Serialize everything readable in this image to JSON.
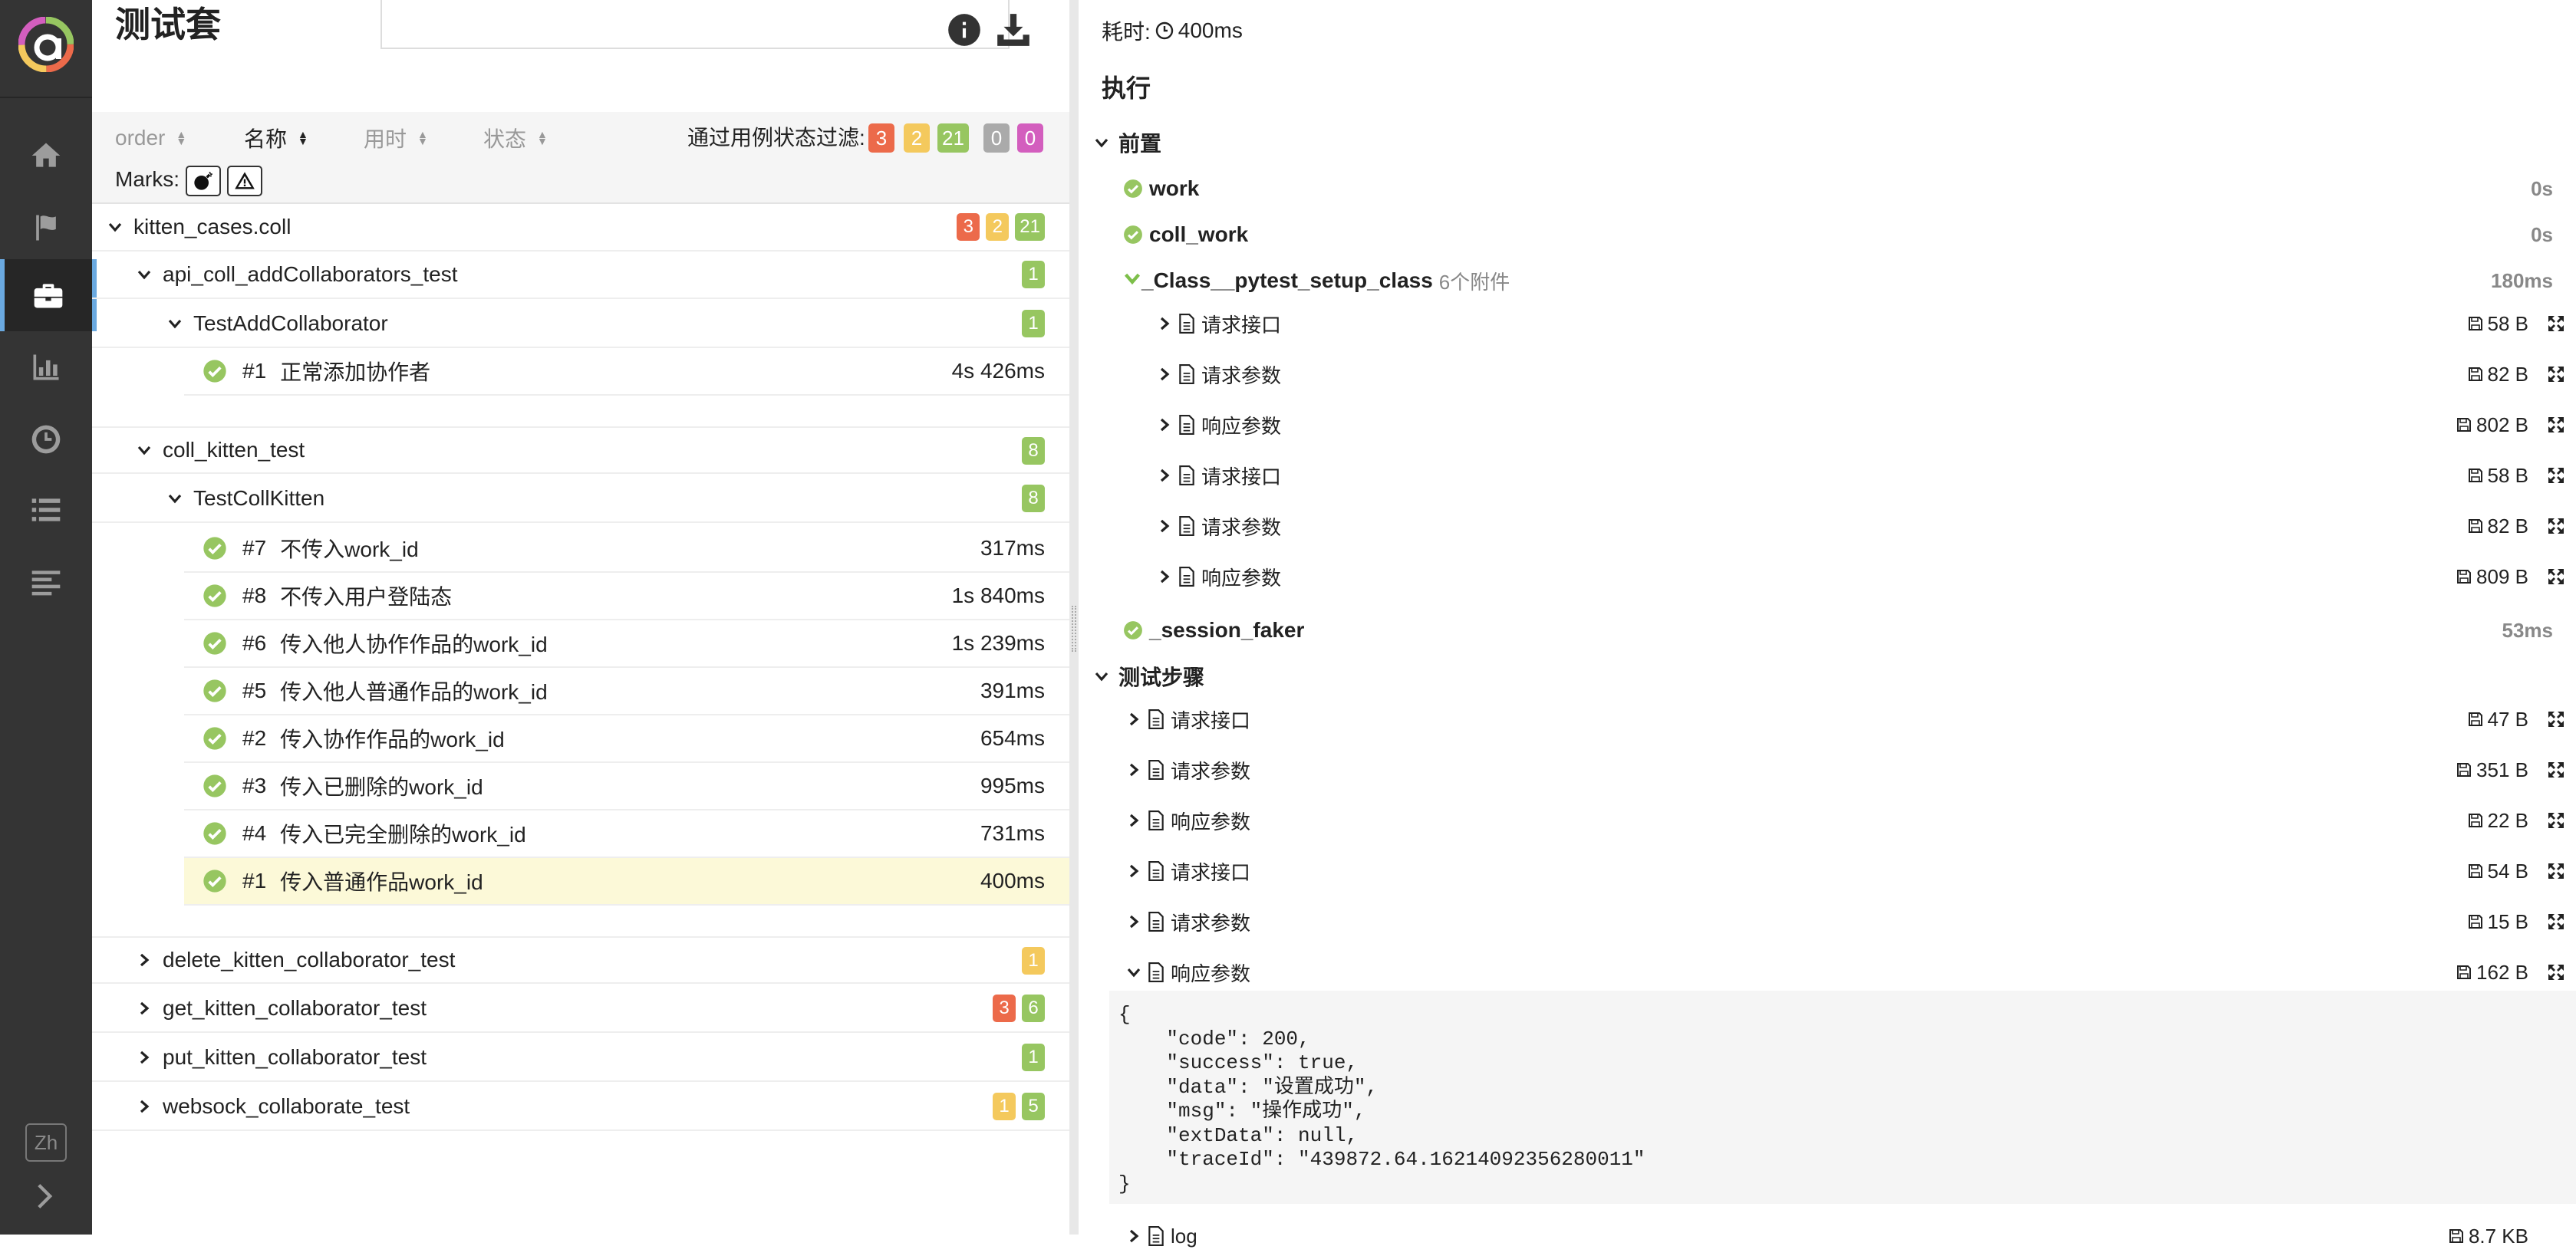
{
  "sidebar": {
    "nav": [
      "overview",
      "categories",
      "suites",
      "graphs",
      "timeline",
      "behaviors",
      "packages"
    ],
    "active": "suites",
    "language": "Zh",
    "colors": {
      "bg": "#343434",
      "active_bar": "#6aa9e0"
    }
  },
  "left": {
    "title": "测试套",
    "search": {
      "value": "",
      "placeholder": ""
    },
    "sort": [
      {
        "label": "order",
        "active": false
      },
      {
        "label": "名称",
        "active": true
      },
      {
        "label": "用时",
        "active": false
      },
      {
        "label": "状态",
        "active": false
      }
    ],
    "filter": {
      "label": "通过用例状态过滤:",
      "counts": [
        "3",
        "2",
        "21",
        "0",
        "0"
      ]
    },
    "marks_label": "Marks:",
    "tree": {
      "root": {
        "name": "kitten_cases.coll",
        "badges": [
          "3",
          "2",
          "21"
        ]
      },
      "groups": [
        {
          "name": "api_coll_addCollaborators_test",
          "badges": [
            "1"
          ],
          "class": {
            "name": "TestAddCollaborator",
            "badges": [
              "1"
            ]
          },
          "cases": [
            {
              "num": "#1",
              "name": "正常添加协作者",
              "dur": "4s 426ms"
            }
          ]
        },
        {
          "name": "coll_kitten_test",
          "badges": [
            "8"
          ],
          "class": {
            "name": "TestCollKitten",
            "badges": [
              "8"
            ]
          },
          "cases": [
            {
              "num": "#7",
              "name": "不传入work_id",
              "dur": "317ms"
            },
            {
              "num": "#8",
              "name": "不传入用户登陆态",
              "dur": "1s 840ms"
            },
            {
              "num": "#6",
              "name": "传入他人协作作品的work_id",
              "dur": "1s 239ms"
            },
            {
              "num": "#5",
              "name": "传入他人普通作品的work_id",
              "dur": "391ms"
            },
            {
              "num": "#2",
              "name": "传入协作作品的work_id",
              "dur": "654ms"
            },
            {
              "num": "#3",
              "name": "传入已删除的work_id",
              "dur": "995ms"
            },
            {
              "num": "#4",
              "name": "传入已完全删除的work_id",
              "dur": "731ms"
            },
            {
              "num": "#1",
              "name": "传入普通作品work_id",
              "dur": "400ms"
            }
          ]
        }
      ],
      "collapsed": [
        {
          "name": "delete_kitten_collaborator_test",
          "badges": [
            "1"
          ]
        },
        {
          "name": "get_kitten_collaborator_test",
          "badges": [
            "3",
            "6"
          ]
        },
        {
          "name": "put_kitten_collaborator_test",
          "badges": [
            "1"
          ]
        },
        {
          "name": "websock_collaborate_test",
          "badges": [
            "1",
            "5"
          ]
        }
      ]
    }
  },
  "right": {
    "duration_label": "耗时:",
    "duration_value": "400ms",
    "exec_title": "执行",
    "setup_title": "前置",
    "setup_steps": [
      {
        "name": "work",
        "dur": "0s"
      },
      {
        "name": "coll_work",
        "dur": "0s"
      },
      {
        "name": "_Class__pytest_setup_class",
        "extra": "6个附件",
        "dur": "180ms"
      },
      {
        "name": "_session_faker",
        "dur": "53ms"
      }
    ],
    "setup_attachments": [
      {
        "name": "请求接口",
        "size": "58 B"
      },
      {
        "name": "请求参数",
        "size": "82 B"
      },
      {
        "name": "响应参数",
        "size": "802 B"
      },
      {
        "name": "请求接口",
        "size": "58 B"
      },
      {
        "name": "请求参数",
        "size": "82 B"
      },
      {
        "name": "响应参数",
        "size": "809 B"
      }
    ],
    "test_title": "测试步骤",
    "test_attachments": [
      {
        "name": "请求接口",
        "size": "47 B"
      },
      {
        "name": "请求参数",
        "size": "351 B"
      },
      {
        "name": "响应参数",
        "size": "22 B"
      },
      {
        "name": "请求接口",
        "size": "54 B"
      },
      {
        "name": "请求参数",
        "size": "15 B"
      },
      {
        "name": "响应参数",
        "size": "162 B"
      }
    ],
    "json_lines": [
      "{",
      "    \"code\": 200,",
      "    \"success\": true,",
      "    \"data\": \"设置成功\",",
      "    \"msg\": \"操作成功\",",
      "    \"extData\": null,",
      "    \"traceId\": \"439872.64.16214092356280011\"",
      "}"
    ],
    "log_row": {
      "name": "log",
      "size": "8.7 KB"
    }
  }
}
